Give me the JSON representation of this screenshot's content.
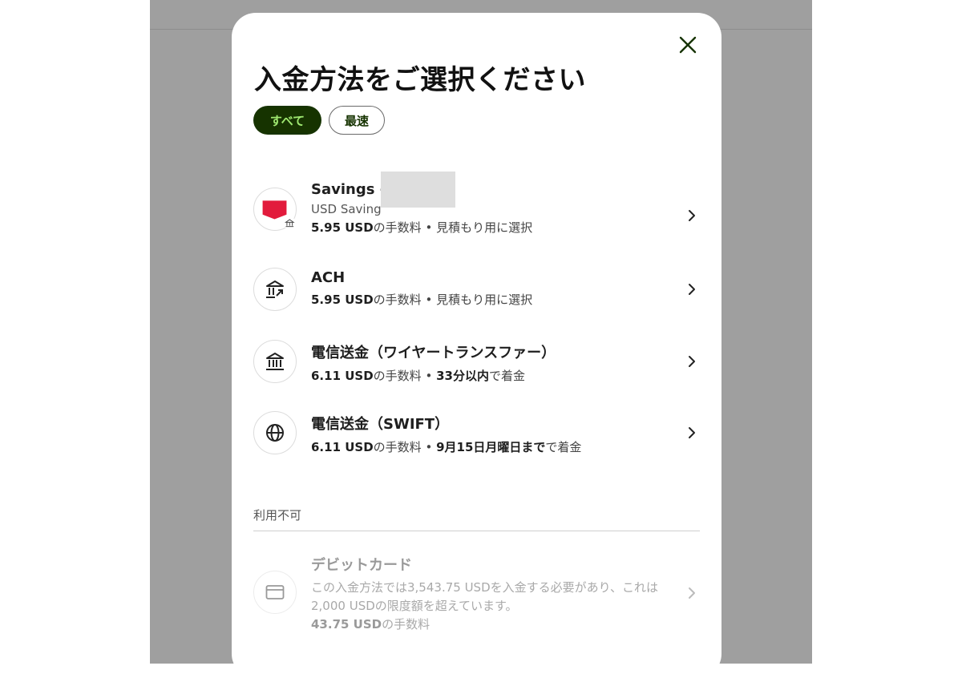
{
  "modal": {
    "title": "入金方法をご選択ください",
    "filters": [
      {
        "label": "すべて",
        "active": true
      },
      {
        "label": "最速",
        "active": false
      }
    ]
  },
  "methods": [
    {
      "title": "Savings - ",
      "subtitle": "USD Saving",
      "fee_amount": "5.95 USD",
      "fee_suffix": "の手数料",
      "dot": "•",
      "note": "見積もり用に選択",
      "icon": "bank-flag-icon"
    },
    {
      "title": "ACH",
      "fee_amount": "5.95 USD",
      "fee_suffix": "の手数料",
      "dot": "•",
      "note": "見積もり用に選択",
      "icon": "bank-transfer-icon"
    },
    {
      "title": "電信送金（ワイヤートランスファー）",
      "fee_amount": "6.11 USD",
      "fee_suffix": "の手数料",
      "dot": "•",
      "eta_bold": "33分以内",
      "eta_suffix": "で着金",
      "icon": "bank-icon"
    },
    {
      "title": "電信送金（SWIFT）",
      "fee_amount": "6.11 USD",
      "fee_suffix": "の手数料",
      "dot": "•",
      "eta_bold": "9月15日月曜日まで",
      "eta_suffix": "で着金",
      "icon": "globe-icon"
    }
  ],
  "unavailable": {
    "label": "利用不可",
    "items": [
      {
        "title": "デビットカード",
        "description": "この入金方法では3,543.75 USDを入金する必要があり、これは2,000 USDの限度額を超えています。",
        "fee_amount": "43.75 USD",
        "fee_suffix": "の手数料",
        "icon": "card-icon"
      }
    ]
  },
  "colors": {
    "accent_dark": "#163300",
    "accent_light": "#9fe870",
    "bank_red": "#e21b3c",
    "overlay": "#9f9f9f"
  }
}
